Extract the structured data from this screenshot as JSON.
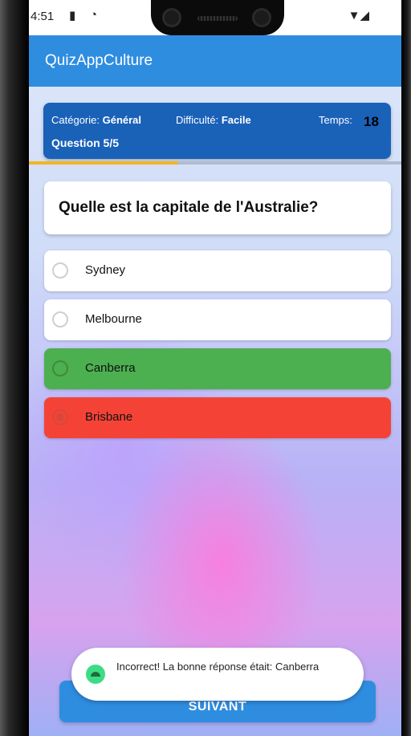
{
  "status_bar": {
    "time": "4:51",
    "left_icons": [
      "sd-card-icon",
      "sync-icon"
    ],
    "right_icons": [
      "wifi-icon",
      "signal-icon"
    ]
  },
  "app": {
    "title": "QuizAppCulture"
  },
  "quiz_info": {
    "category_label": "Catégorie:",
    "category_value": "Général",
    "difficulty_label": "Difficulté:",
    "difficulty_value": "Facile",
    "time_label": "Temps:",
    "time_value": "18",
    "question_counter": "Question 5/5"
  },
  "progress": {
    "fraction": 0.4
  },
  "question": {
    "text": "Quelle est la capitale de l'Australie?"
  },
  "answers": [
    {
      "label": "Sydney",
      "state": "neutral"
    },
    {
      "label": "Melbourne",
      "state": "neutral"
    },
    {
      "label": "Canberra",
      "state": "correct"
    },
    {
      "label": "Brisbane",
      "state": "wrong-selected"
    }
  ],
  "next_button": {
    "label": "SUIVANT"
  },
  "toast": {
    "message": "Incorrect! La bonne réponse était: Canberra",
    "icon": "android-icon"
  },
  "colors": {
    "app_bar": "#2f8de0",
    "info_card": "#1a61b8",
    "progress": "#f3b61f",
    "correct": "#4caf50",
    "wrong": "#f44336"
  }
}
